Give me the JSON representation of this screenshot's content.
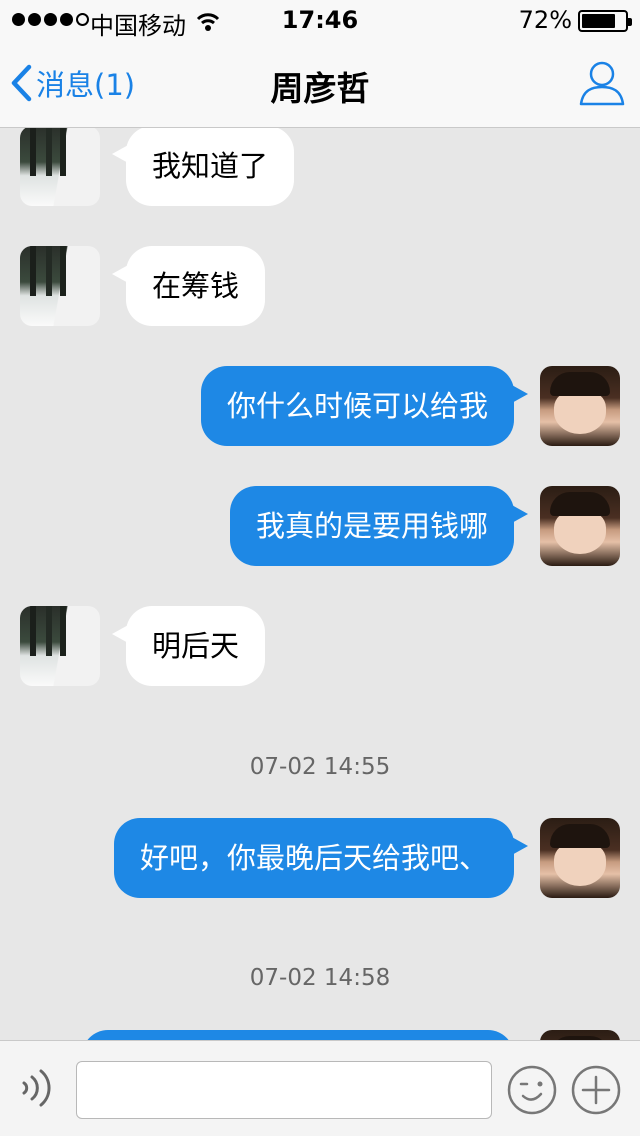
{
  "status_bar": {
    "carrier": "中国移动",
    "time": "17:46",
    "battery": "72%",
    "battery_level": 0.72,
    "signal_bars": 4
  },
  "nav": {
    "back_label": "消息(1)",
    "title": "周彦哲",
    "icons": {
      "back": "chevron-left-icon",
      "profile": "person-icon"
    }
  },
  "colors": {
    "accent": "#1a82e6",
    "outgoing_bubble": "#1e88e5",
    "incoming_bubble": "#ffffff",
    "background": "#e7e7e7"
  },
  "messages": [
    {
      "direction": "in",
      "text": "我知道了"
    },
    {
      "direction": "in",
      "text": "在筹钱"
    },
    {
      "direction": "out",
      "text": "你什么时候可以给我"
    },
    {
      "direction": "out",
      "text": "我真的是要用钱哪"
    },
    {
      "direction": "in",
      "text": "明后天"
    },
    {
      "type": "timestamp",
      "text": "07-02 14:55"
    },
    {
      "direction": "out",
      "text": "好吧，你最晚后天给我吧、"
    },
    {
      "type": "timestamp",
      "text": "07-02 14:58"
    }
  ],
  "input_bar": {
    "value": "",
    "placeholder": "",
    "icons": {
      "voice": "voice-icon",
      "emoji": "emoji-icon",
      "plus": "plus-icon"
    }
  }
}
